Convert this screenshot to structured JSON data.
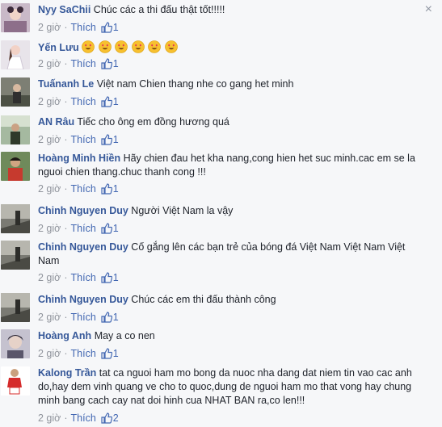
{
  "ui": {
    "close_symbol": "×",
    "like_label": "Thích"
  },
  "comments": [
    {
      "name": "Nyy SaChii",
      "text": "Chúc các a thi đấu thật tốt!!!!!",
      "time": "2 giờ",
      "likes": "1"
    },
    {
      "name": "Yến Lưu",
      "text": "",
      "emoji_count": 6,
      "time": "2 giờ",
      "likes": "1"
    },
    {
      "name": "Tuấnanh Le",
      "text": "Việt nam Chien thang nhe co gang het minh",
      "time": "2 giờ",
      "likes": "1"
    },
    {
      "name": "AN Râu",
      "text": "Tiếc cho ông em đồng hương quá",
      "time": "2 giờ",
      "likes": "1"
    },
    {
      "name": "Hoàng Minh Hiền",
      "text": "Hãy chien đau het kha nang,cong hien het suc minh.cac em se la nguoi chien thang.chuc thanh cong !!!",
      "time": "2 giờ",
      "likes": "1"
    },
    {
      "name": "Chinh Nguyen Duy",
      "text": "Người Việt Nam la vậy",
      "time": "2 giờ",
      "likes": "1"
    },
    {
      "name": "Chinh Nguyen Duy",
      "text": "Cố gắng lên các bạn trẻ của bóng đá Việt Nam Việt Nam Việt Nam",
      "time": "2 giờ",
      "likes": "1"
    },
    {
      "name": "Chinh Nguyen Duy",
      "text": "Chúc các em thi đấu thành công",
      "time": "2 giờ",
      "likes": "1"
    },
    {
      "name": "Hoàng Anh",
      "text": "May a co nen",
      "time": "2 giờ",
      "likes": "1"
    },
    {
      "name": "Kalong Trần",
      "text": "tat ca nguoi ham mo bong da nuoc nha dang dat niem tin vao cac anh do,hay dem vinh quang ve cho to quoc,dung de nguoi ham mo that vong hay chung minh bang cach cay nat doi hinh cua NHAT BAN ra,co len!!!",
      "time": "2 giờ",
      "likes": "2"
    }
  ]
}
